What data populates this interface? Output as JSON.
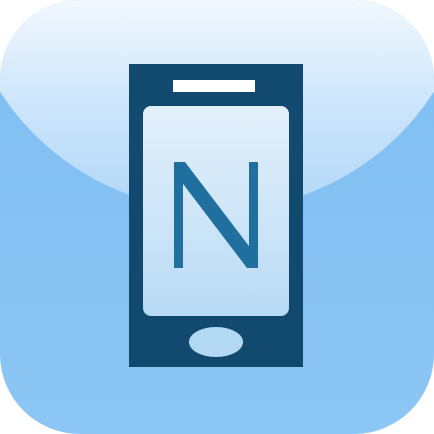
{
  "app_icon": {
    "name": "N mobile app",
    "glyph": "N",
    "colors": {
      "background": "#86c2f3",
      "phone_body": "#114a6e",
      "screen": "#cfe6f8",
      "letter": "#1f6f9f",
      "speaker": "#ffffff"
    }
  }
}
